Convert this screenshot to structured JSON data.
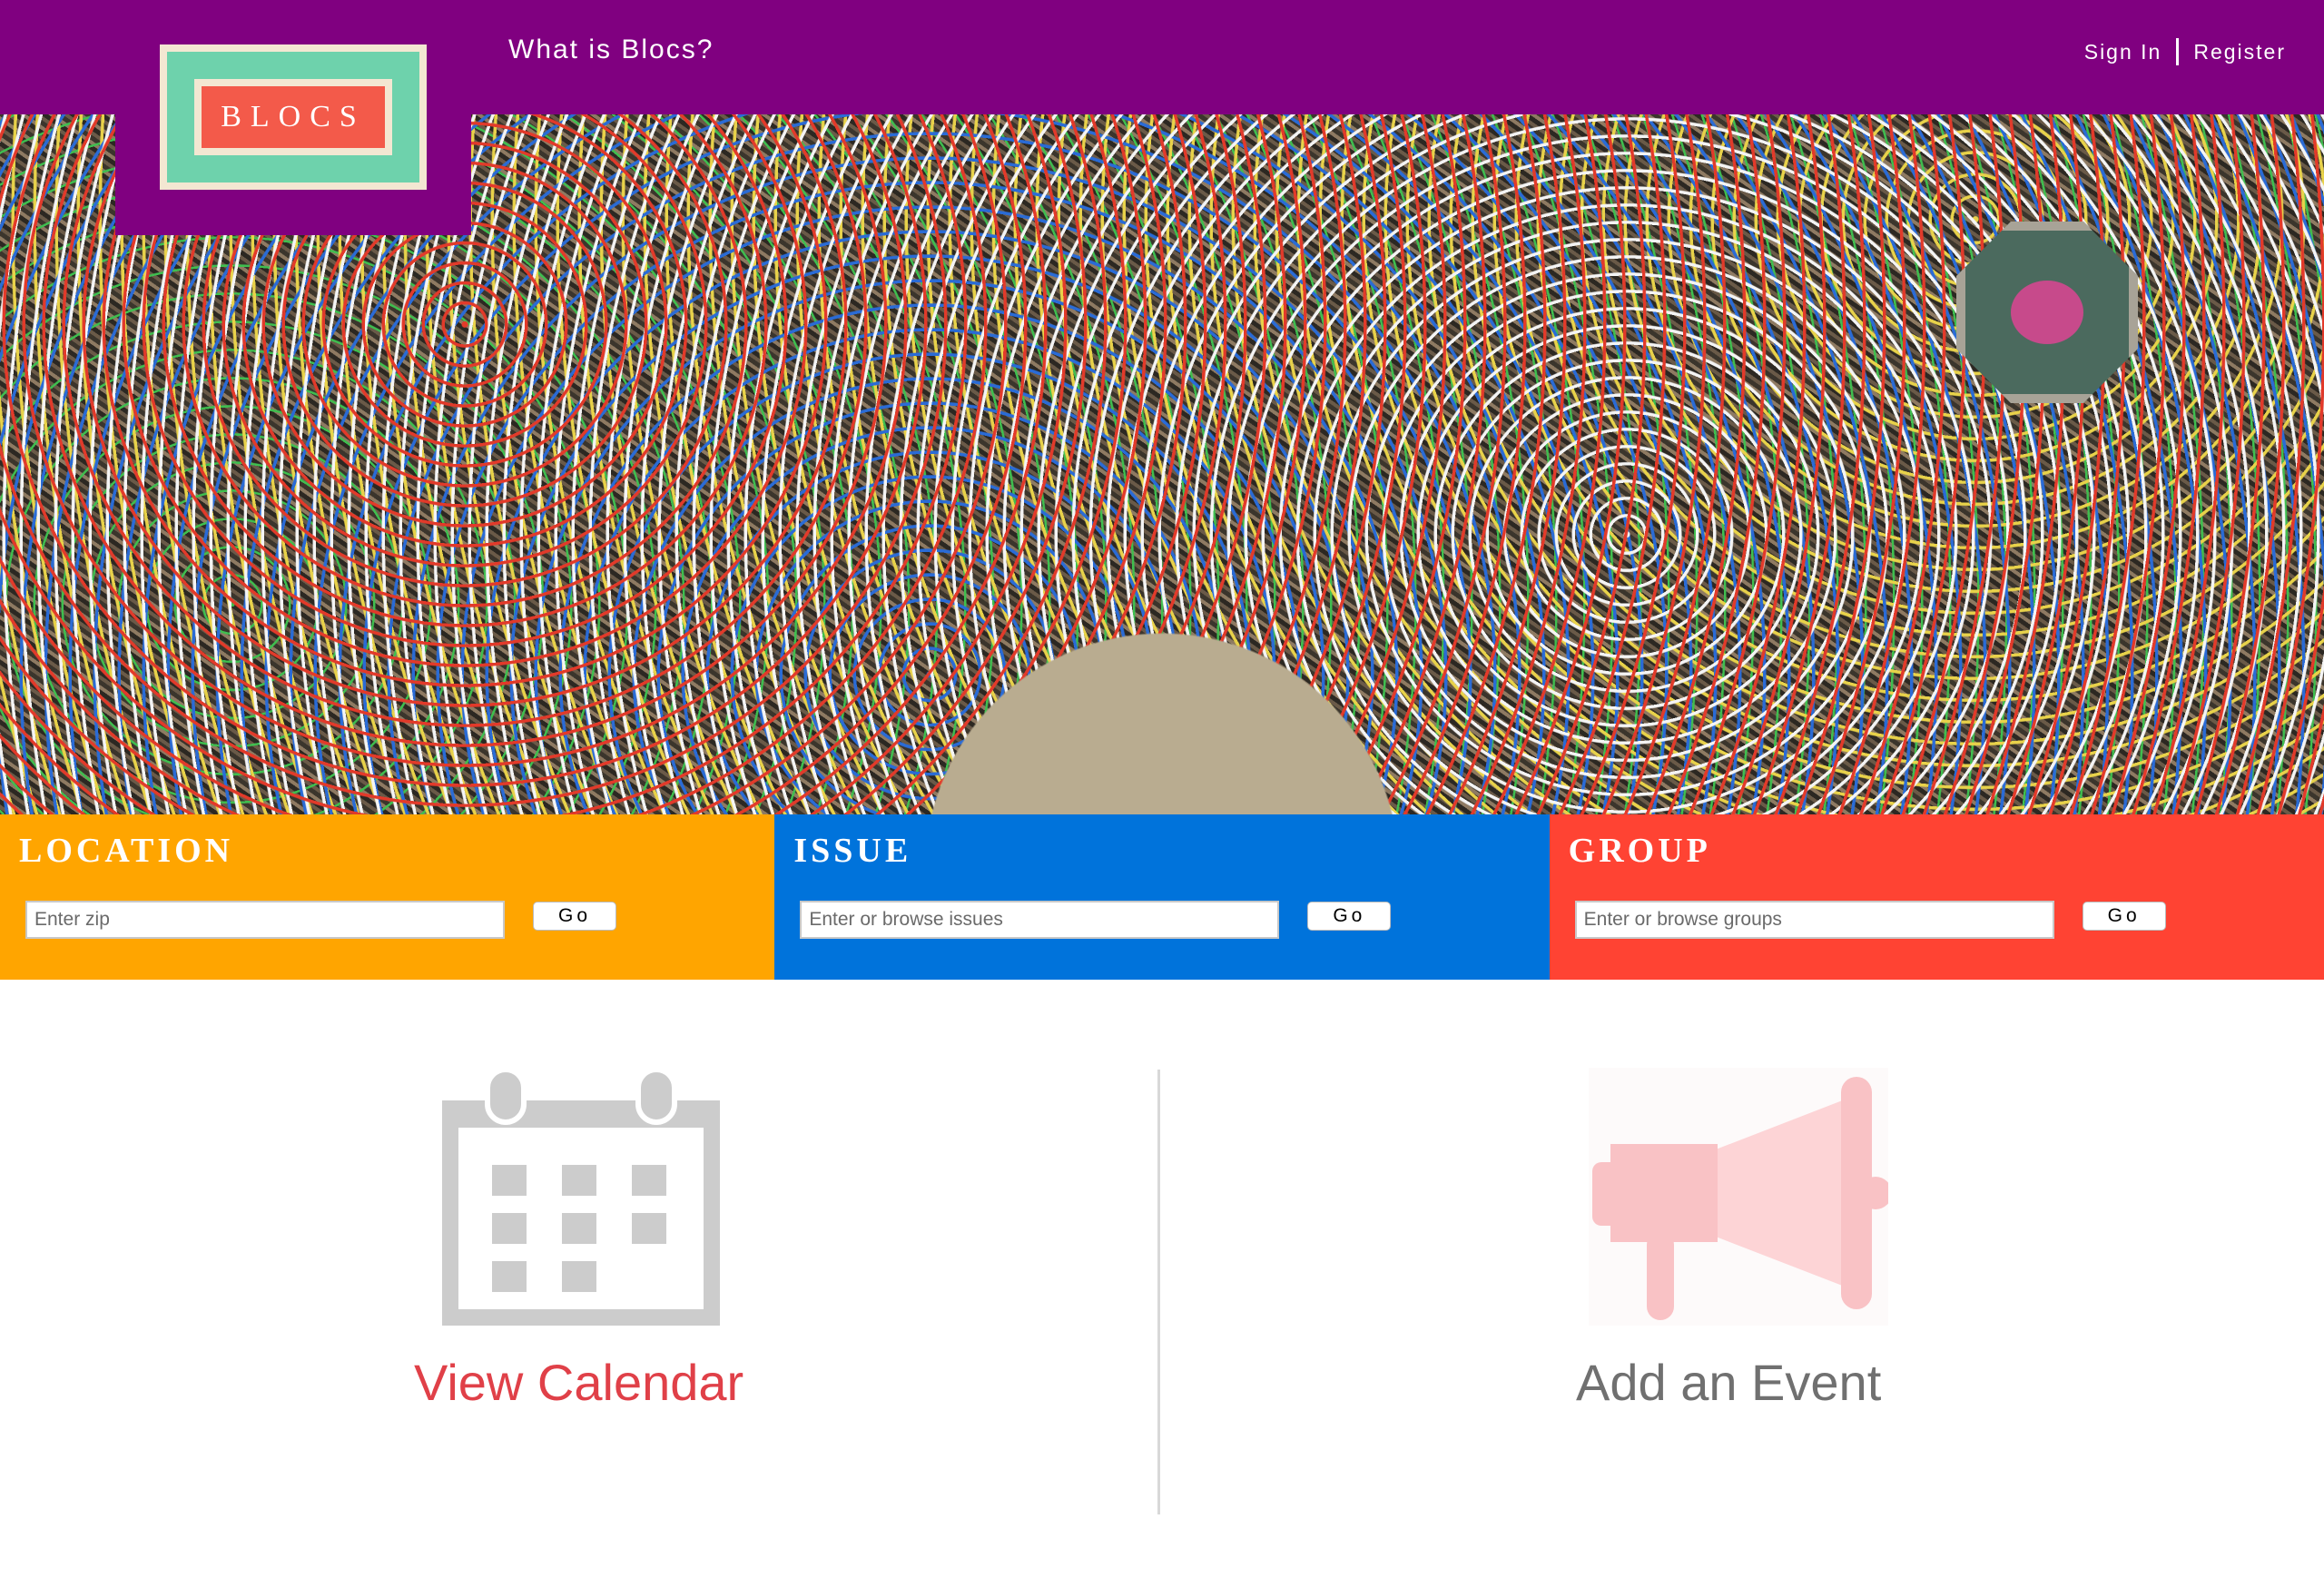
{
  "header": {
    "logo_text": "BLOCS",
    "nav_link": "What is Blocs?",
    "sign_in": "Sign In",
    "register": "Register"
  },
  "hero": {
    "image": "crowd-aerial-photo"
  },
  "search": [
    {
      "title": "LOCATION",
      "placeholder": "Enter zip",
      "button": "Go",
      "color": "#FFA500"
    },
    {
      "title": "ISSUE",
      "placeholder": "Enter or browse issues",
      "button": "Go",
      "color": "#0073DB"
    },
    {
      "title": "GROUP",
      "placeholder": "Enter or browse groups",
      "button": "Go",
      "color": "#FF4333"
    }
  ],
  "actions": {
    "calendar": {
      "label": "View Calendar",
      "icon": "calendar-icon",
      "color": "#E04048"
    },
    "event": {
      "label": "Add an Event",
      "icon": "megaphone-icon",
      "color": "#707070"
    }
  },
  "colors": {
    "header": "#800080",
    "logo_teal": "#6ED2AC",
    "logo_red": "#F35A4A",
    "logo_cream": "#F3E7D2"
  }
}
